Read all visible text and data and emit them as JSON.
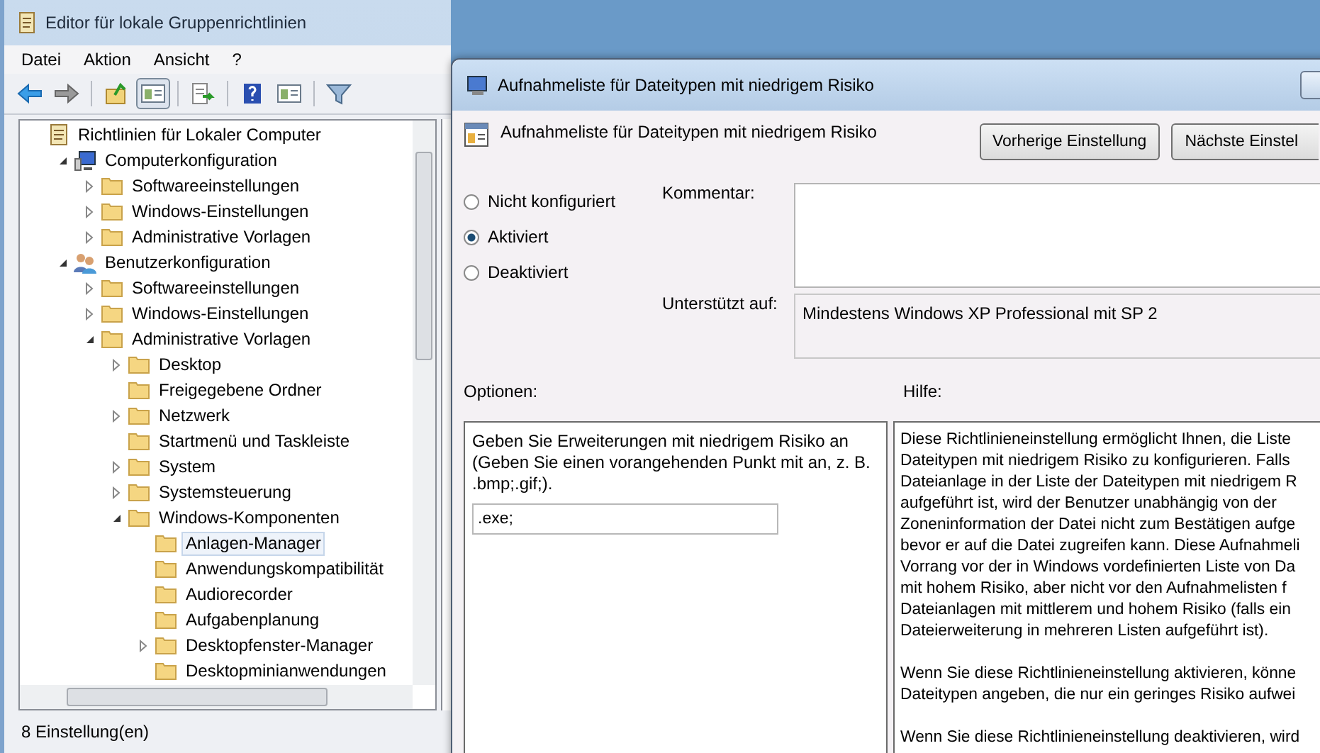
{
  "main_window": {
    "title": "Editor für lokale Gruppenrichtlinien",
    "menu": [
      "Datei",
      "Aktion",
      "Ansicht",
      "?"
    ],
    "toolbar": [
      {
        "kind": "back"
      },
      {
        "kind": "forward"
      },
      {
        "kind": "sep"
      },
      {
        "kind": "up"
      },
      {
        "kind": "pane",
        "selected": true
      },
      {
        "kind": "sep"
      },
      {
        "kind": "export"
      },
      {
        "kind": "sep"
      },
      {
        "kind": "help"
      },
      {
        "kind": "pane2"
      },
      {
        "kind": "sep"
      },
      {
        "kind": "filter"
      }
    ],
    "tree": [
      {
        "label": "Richtlinien für Lokaler Computer",
        "kind": "policy",
        "selected": false,
        "children": [
          {
            "label": "Computerkonfiguration",
            "kind": "computer",
            "expanded": true,
            "selected": false,
            "children": [
              {
                "label": "Softwareeinstellungen",
                "kind": "folder",
                "expanded": false,
                "selected": false
              },
              {
                "label": "Windows-Einstellungen",
                "kind": "folder",
                "expanded": false,
                "selected": false
              },
              {
                "label": "Administrative Vorlagen",
                "kind": "folder",
                "expanded": false,
                "selected": false
              }
            ]
          },
          {
            "label": "Benutzerkonfiguration",
            "kind": "user",
            "expanded": true,
            "selected": false,
            "children": [
              {
                "label": "Softwareeinstellungen",
                "kind": "folder",
                "expanded": false,
                "selected": false
              },
              {
                "label": "Windows-Einstellungen",
                "kind": "folder",
                "expanded": false,
                "selected": false
              },
              {
                "label": "Administrative Vorlagen",
                "kind": "folder",
                "expanded": true,
                "selected": false,
                "children": [
                  {
                    "label": "Desktop",
                    "kind": "folder",
                    "expanded": false,
                    "selected": false
                  },
                  {
                    "label": "Freigegebene Ordner",
                    "kind": "folder",
                    "selected": false
                  },
                  {
                    "label": "Netzwerk",
                    "kind": "folder",
                    "expanded": false,
                    "selected": false
                  },
                  {
                    "label": "Startmenü und Taskleiste",
                    "kind": "folder",
                    "selected": false
                  },
                  {
                    "label": "System",
                    "kind": "folder",
                    "expanded": false,
                    "selected": false
                  },
                  {
                    "label": "Systemsteuerung",
                    "kind": "folder",
                    "expanded": false,
                    "selected": false
                  },
                  {
                    "label": "Windows-Komponenten",
                    "kind": "folder",
                    "expanded": true,
                    "selected": false,
                    "children": [
                      {
                        "label": "Anlagen-Manager",
                        "kind": "folder",
                        "selected": true
                      },
                      {
                        "label": "Anwendungskompatibilität",
                        "kind": "folder",
                        "selected": false
                      },
                      {
                        "label": "Audiorecorder",
                        "kind": "folder",
                        "selected": false
                      },
                      {
                        "label": "Aufgabenplanung",
                        "kind": "folder",
                        "selected": false
                      },
                      {
                        "label": "Desktopfenster-Manager",
                        "kind": "folder",
                        "expanded": false,
                        "selected": false
                      },
                      {
                        "label": "Desktopminianwendungen",
                        "kind": "folder",
                        "selected": false
                      }
                    ]
                  }
                ]
              }
            ]
          }
        ]
      }
    ],
    "status_bar": "8 Einstellung(en)"
  },
  "dialog": {
    "title": "Aufnahmeliste für Dateitypen mit niedrigem Risiko",
    "heading": "Aufnahmeliste für Dateitypen mit niedrigem Risiko",
    "buttons": [
      "Vorherige Einstellung",
      "Nächste Einstel"
    ],
    "radios": [
      {
        "label": "Nicht konfiguriert",
        "selected": false
      },
      {
        "label": "Aktiviert",
        "selected": true
      },
      {
        "label": "Deaktiviert",
        "selected": false
      }
    ],
    "comment_label": "Kommentar:",
    "supported_label": "Unterstützt auf:",
    "supported_value": "Mindestens Windows XP Professional mit SP 2",
    "options_label": "Optionen:",
    "help_label": "Hilfe:",
    "options_text": "Geben Sie Erweiterungen mit niedrigem Risiko an (Geben Sie einen vorangehenden Punkt mit an, z. B. .bmp;.gif;).",
    "extensions_value": ".exe;",
    "help_paragraphs": [
      [
        "Diese Richtlinieneinstellung ermöglicht Ihnen, die Liste",
        "Dateitypen mit niedrigem Risiko zu konfigurieren. Falls",
        "Dateianlage in der Liste der Dateitypen mit niedrigem R",
        "aufgeführt ist, wird der Benutzer unabhängig von der",
        "Zoneninformation der Datei nicht zum Bestätigen aufge",
        "bevor er auf die Datei zugreifen kann. Diese Aufnahmeli",
        "Vorrang vor der in Windows vordefinierten Liste von Da",
        "mit hohem Risiko, aber nicht vor den Aufnahmelisten f",
        "Dateianlagen mit mittlerem und hohem Risiko (falls ein",
        "Dateierweiterung in mehreren Listen aufgeführt ist)."
      ],
      [
        "Wenn Sie diese Richtlinieneinstellung aktivieren, könne",
        "Dateitypen angeben, die nur ein geringes Risiko aufwei"
      ],
      [
        "Wenn Sie diese Richtlinieneinstellung deaktivieren, wird"
      ]
    ]
  }
}
